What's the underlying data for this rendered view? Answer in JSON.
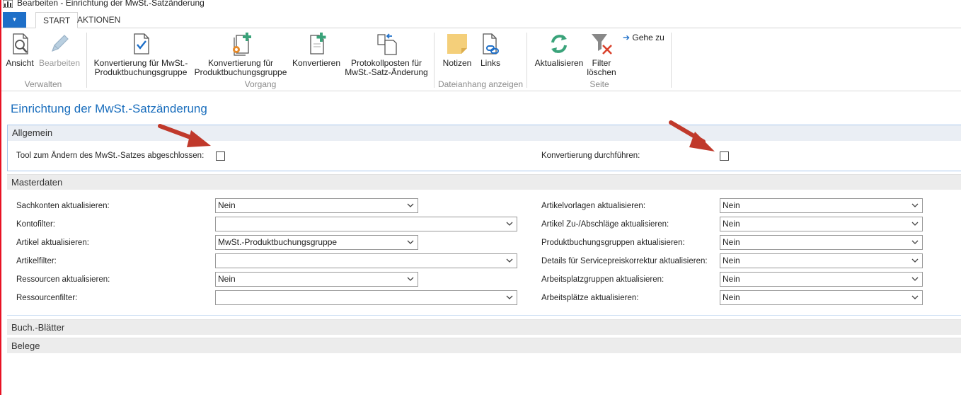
{
  "window": {
    "title": "Bearbeiten - Einrichtung der MwSt.-Satzänderung"
  },
  "tabs": [
    {
      "label": "START",
      "active": true
    },
    {
      "label": "AKTIONEN",
      "active": false
    }
  ],
  "ribbon": {
    "verwalten": {
      "group_label": "Verwalten",
      "ansicht": "Ansicht",
      "bearbeiten": "Bearbeiten"
    },
    "vorgang": {
      "group_label": "Vorgang",
      "konv1_line1": "Konvertierung für MwSt.-",
      "konv1_line2": "Produktbuchungsgruppe",
      "konv2_line1": "Konvertierung für",
      "konv2_line2": "Produktbuchungsgruppe",
      "konvertieren": "Konvertieren",
      "proto_line1": "Protokollposten für",
      "proto_line2": "MwSt.-Satz-Änderung"
    },
    "dateianhang": {
      "group_label": "Dateianhang anzeigen",
      "notizen": "Notizen",
      "links": "Links"
    },
    "seite": {
      "group_label": "Seite",
      "aktualisieren": "Aktualisieren",
      "filter_line1": "Filter",
      "filter_line2": "löschen",
      "gehe_zu": "Gehe zu"
    }
  },
  "page_title": "Einrichtung der MwSt.-Satzänderung",
  "allgemein": {
    "header": "Allgemein",
    "tool_label": "Tool zum Ändern des MwSt.-Satzes abgeschlossen:",
    "tool_checked": false,
    "konv_label": "Konvertierung durchführen:",
    "konv_checked": false
  },
  "masterdaten": {
    "header": "Masterdaten",
    "left": [
      {
        "label": "Sachkonten aktualisieren:",
        "value": "Nein"
      },
      {
        "label": "Kontofilter:",
        "value": ""
      },
      {
        "label": "Artikel aktualisieren:",
        "value": "MwSt.-Produktbuchungsgruppe"
      },
      {
        "label": "Artikelfilter:",
        "value": ""
      },
      {
        "label": "Ressourcen aktualisieren:",
        "value": "Nein"
      },
      {
        "label": "Ressourcenfilter:",
        "value": ""
      }
    ],
    "right": [
      {
        "label": "Artikelvorlagen aktualisieren:",
        "value": "Nein"
      },
      {
        "label": "Artikel Zu-/Abschläge aktualisieren:",
        "value": "Nein"
      },
      {
        "label": "Produktbuchungsgruppen aktualisieren:",
        "value": "Nein"
      },
      {
        "label": "Details für Servicepreiskorrektur aktualisieren:",
        "value": "Nein"
      },
      {
        "label": "Arbeitsplatzgruppen aktualisieren:",
        "value": "Nein"
      },
      {
        "label": "Arbeitsplätze aktualisieren:",
        "value": "Nein"
      }
    ]
  },
  "sections": {
    "buch": "Buch.-Blätter",
    "belege": "Belege"
  },
  "colors": {
    "accent": "#1e6fc8",
    "title_blue": "#1a6ebd",
    "arrow_red": "#c0392b",
    "window_border": "#e81123"
  }
}
